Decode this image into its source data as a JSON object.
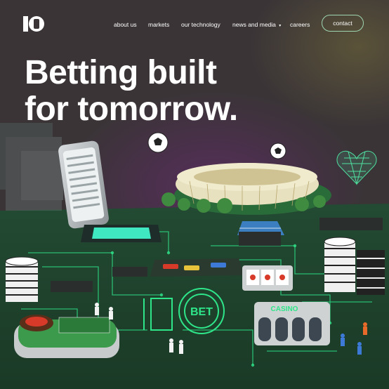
{
  "brand": {
    "logo_text": "10BET"
  },
  "nav": {
    "items": [
      {
        "label": "about us"
      },
      {
        "label": "markets"
      },
      {
        "label": "our technology"
      },
      {
        "label": "news and media",
        "has_dropdown": true
      },
      {
        "label": "careers"
      }
    ],
    "contact_label": "contact"
  },
  "hero": {
    "title_line1": "Betting built",
    "title_line2": "for tomorrow."
  },
  "scene": {
    "casino_sign": "CASINO",
    "bet_logo": "BET"
  },
  "colors": {
    "background": "#3a3437",
    "accent_green": "#2fe58a",
    "text": "#ffffff",
    "button_border": "#9fd6b2"
  }
}
